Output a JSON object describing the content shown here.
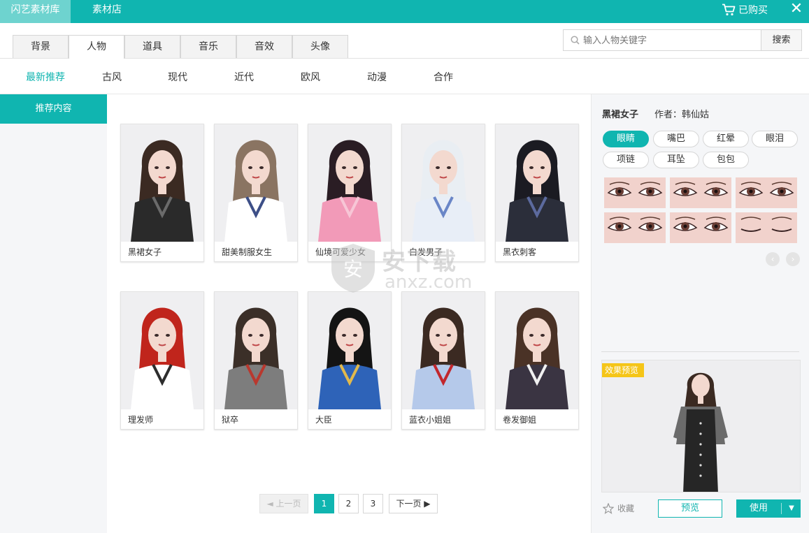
{
  "topbar": {
    "tab_library": "闪艺素材库",
    "tab_store": "素材店",
    "purchased_label": "已购买",
    "close_label": "✕",
    "bg_color": "#10b5b0"
  },
  "category_tabs": [
    "背景",
    "人物",
    "道具",
    "音乐",
    "音效",
    "头像"
  ],
  "active_category": "人物",
  "search": {
    "placeholder": "输入人物关键字",
    "button_label": "搜索"
  },
  "sub_tabs": [
    "最新推荐",
    "古风",
    "现代",
    "近代",
    "欧风",
    "动漫",
    "合作"
  ],
  "active_sub_tab": "最新推荐",
  "sidebar": {
    "item_label": "推荐内容"
  },
  "cards": [
    {
      "name": "黑裙女子",
      "hair": "#3b2a22",
      "outfit": "#2a2a2a",
      "accent": "#6b6b6b"
    },
    {
      "name": "甜美制服女生",
      "hair": "#8a7462",
      "outfit": "#ffffff",
      "accent": "#3d4f87"
    },
    {
      "name": "仙境可爱少女",
      "hair": "#2a1d24",
      "outfit": "#f29ab8",
      "accent": "#f7c6d6"
    },
    {
      "name": "白发男子",
      "hair": "#e9eef3",
      "outfit": "#e8eef7",
      "accent": "#6a86c7"
    },
    {
      "name": "黑衣刺客",
      "hair": "#1b1b22",
      "outfit": "#2b2e3a",
      "accent": "#5c6a9e"
    },
    {
      "name": "理发师",
      "hair": "#c0251c",
      "outfit": "#ffffff",
      "accent": "#2d2d2d"
    },
    {
      "name": "狱卒",
      "hair": "#3b2f28",
      "outfit": "#7d7d7d",
      "accent": "#b9382e"
    },
    {
      "name": "大臣",
      "hair": "#141414",
      "outfit": "#2e63b8",
      "accent": "#e1b94c"
    },
    {
      "name": "蓝衣小姐姐",
      "hair": "#3b2a22",
      "outfit": "#b5c9ea",
      "accent": "#c2272d"
    },
    {
      "name": "卷发御姐",
      "hair": "#4a3226",
      "outfit": "#3a3442",
      "accent": "#f0f0f0"
    }
  ],
  "pagination": {
    "prev_label": "◄ 上一页",
    "pages": [
      "1",
      "2",
      "3"
    ],
    "active_page": "1",
    "next_label": "下一页 ▶"
  },
  "watermark": {
    "line1": "安下载",
    "line2": "anxz.com"
  },
  "detail": {
    "title": "黑裙女子",
    "author": "作者：韩仙姑",
    "feature_chips": [
      "眼睛",
      "嘴巴",
      "红晕",
      "眼泪",
      "项链",
      "耳坠",
      "包包"
    ],
    "active_chip": "眼睛",
    "eye_variants": 6,
    "preview_badge": "效果预览",
    "favorite_label": "收藏",
    "preview_button": "预览",
    "use_button": "使用"
  }
}
